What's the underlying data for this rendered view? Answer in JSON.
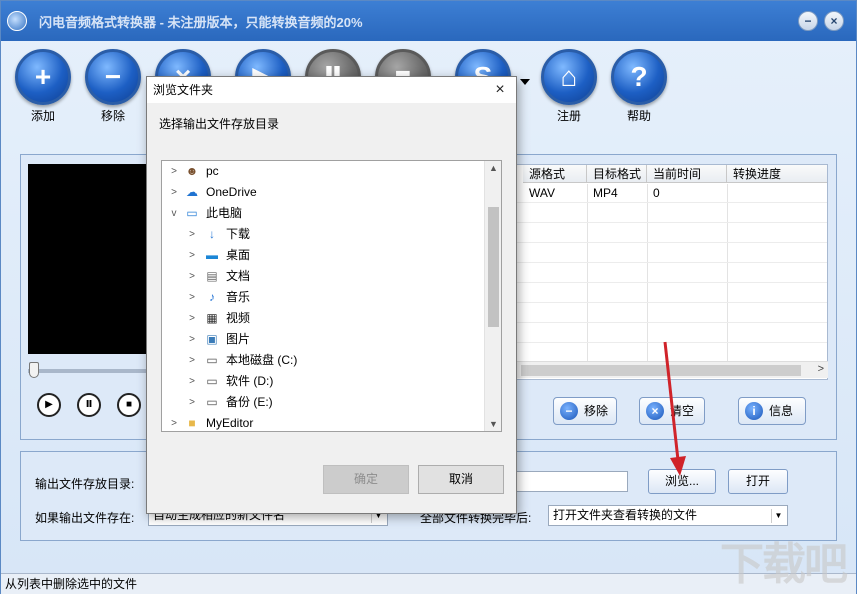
{
  "window": {
    "title": "闪电音频格式转换器 - 未注册版本，只能转换音频的20%",
    "min_label": "−",
    "close_label": "×"
  },
  "toolbar": {
    "add_label": "添加",
    "remove_label": "移除",
    "register_label": "注册",
    "help_label": "帮助"
  },
  "file_table": {
    "headers": [
      "源格式",
      "目标格式",
      "当前时间",
      "转换进度"
    ],
    "row": {
      "src_format": "WAV",
      "target_format": "MP4",
      "current_time": "0",
      "progress": ""
    }
  },
  "list_buttons": {
    "remove_label": "移除",
    "clear_label": "清空",
    "info_label": "信息"
  },
  "output": {
    "dir_label": "输出文件存放目录:",
    "dir_value": "",
    "browse_label": "浏览...",
    "open_label": "打开",
    "exists_label": "如果输出文件存在:",
    "exists_value": "自动生成相应的新文件名",
    "after_label": "全部文件转换完毕后:",
    "after_value": "打开文件夹查看转换的文件"
  },
  "statusbar": {
    "text": "从列表中删除选中的文件"
  },
  "dialog": {
    "title": "浏览文件夹",
    "close_label": "×",
    "description": "选择输出文件存放目录",
    "ok_label": "确定",
    "cancel_label": "取消",
    "tree": [
      {
        "label": "pc",
        "icon": "user-icon",
        "expand": ">"
      },
      {
        "label": "OneDrive",
        "icon": "cloud-icon",
        "expand": ">"
      },
      {
        "label": "此电脑",
        "icon": "computer-icon",
        "expand": "v"
      },
      {
        "label": "下载",
        "icon": "download-icon",
        "expand": ">"
      },
      {
        "label": "桌面",
        "icon": "desktop-icon",
        "expand": ">"
      },
      {
        "label": "文档",
        "icon": "document-icon",
        "expand": ">"
      },
      {
        "label": "音乐",
        "icon": "music-icon",
        "expand": ">"
      },
      {
        "label": "视频",
        "icon": "video-icon",
        "expand": ">"
      },
      {
        "label": "图片",
        "icon": "picture-icon",
        "expand": ">"
      },
      {
        "label": "本地磁盘 (C:)",
        "icon": "drive-icon",
        "expand": ">"
      },
      {
        "label": "软件 (D:)",
        "icon": "drive-icon",
        "expand": ">"
      },
      {
        "label": "备份 (E:)",
        "icon": "drive-icon",
        "expand": ">"
      },
      {
        "label": "MyEditor",
        "icon": "folder-icon",
        "expand": ">"
      }
    ]
  },
  "colors": {
    "title_bar": "#2a68bd",
    "accent": "#1d5fc4",
    "annotation_arrow": "#d0232a"
  }
}
